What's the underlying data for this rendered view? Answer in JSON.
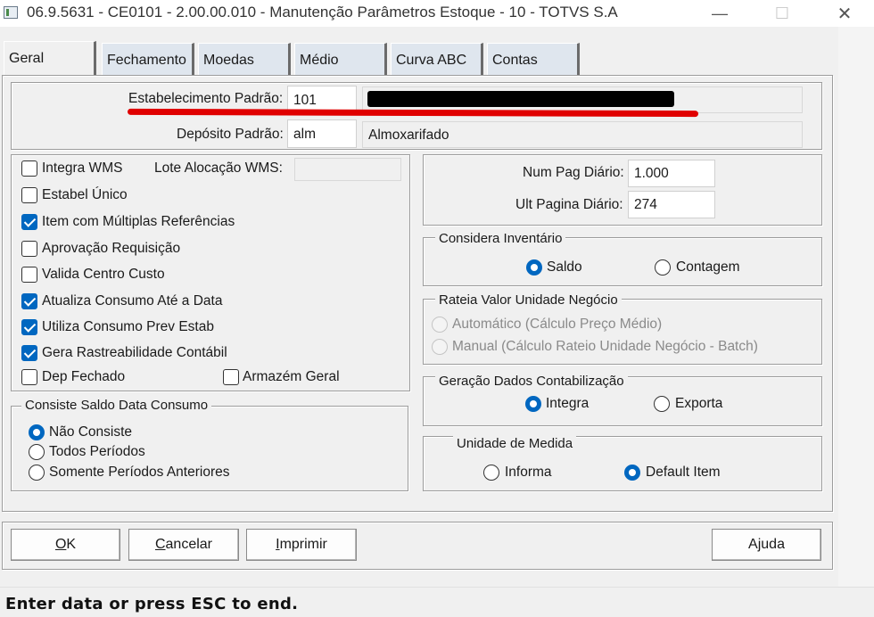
{
  "window": {
    "title": "06.9.5631 - CE0101 - 2.00.00.010 - Manutenção Parâmetros Estoque - 10 - TOTVS S.A",
    "minimize_glyph": "—",
    "maximize_glyph": "☐",
    "close_glyph": "✕"
  },
  "tabs": [
    {
      "label": "Geral",
      "active": true
    },
    {
      "label": "Fechamento"
    },
    {
      "label": "Moedas"
    },
    {
      "label": "Médio"
    },
    {
      "label": "Curva ABC"
    },
    {
      "label": "Contas"
    }
  ],
  "header": {
    "estabelecimento_label": "Estabelecimento Padrão:",
    "estabelecimento_value": "101",
    "estabelecimento_desc": "",
    "deposito_label": "Depósito Padrão:",
    "deposito_value": "alm",
    "deposito_desc": "Almoxarifado"
  },
  "options": {
    "integra_wms": {
      "label": "Integra WMS",
      "checked": false
    },
    "lote_alocacao_label": "Lote Alocação WMS:",
    "lote_alocacao_value": "",
    "estabel_unico": {
      "label": "Estabel Único",
      "checked": false
    },
    "item_multiplas": {
      "label": "Item com Múltiplas Referências",
      "checked": true
    },
    "aprovacao_requisicao": {
      "label": "Aprovação Requisição",
      "checked": false
    },
    "valida_centro_custo": {
      "label": "Valida Centro Custo",
      "checked": false
    },
    "atualiza_consumo": {
      "label": "Atualiza Consumo Até a Data",
      "checked": true
    },
    "utiliza_consumo": {
      "label": "Utiliza Consumo Prev Estab",
      "checked": true
    },
    "gera_rastreabilidade": {
      "label": "Gera Rastreabilidade Contábil",
      "checked": true
    },
    "dep_fechado": {
      "label": "Dep Fechado",
      "checked": false
    },
    "armazem_geral": {
      "label": "Armazém Geral",
      "checked": false
    }
  },
  "consiste_saldo": {
    "legend": "Consiste Saldo Data Consumo",
    "options": [
      {
        "label": "Não Consiste",
        "selected": true
      },
      {
        "label": "Todos Períodos",
        "selected": false
      },
      {
        "label": "Somente Períodos Anteriores",
        "selected": false
      }
    ]
  },
  "diario": {
    "num_pag_label": "Num Pag Diário:",
    "num_pag_value": "1.000",
    "ult_pagina_label": "Ult Pagina Diário:",
    "ult_pagina_value": "274"
  },
  "considera_inventario": {
    "legend": "Considera Inventário",
    "options": [
      {
        "label": "Saldo",
        "selected": true
      },
      {
        "label": "Contagem",
        "selected": false
      }
    ]
  },
  "rateia_valor": {
    "legend": "Rateia Valor Unidade Negócio",
    "options": [
      {
        "label": "Automático (Cálculo Preço Médio)",
        "selected": true,
        "disabled": true
      },
      {
        "label": "Manual (Cálculo Rateio Unidade Negócio - Batch)",
        "selected": false,
        "disabled": true
      }
    ]
  },
  "geracao_dados": {
    "legend": "Geração Dados Contabilização",
    "options": [
      {
        "label": "Integra",
        "selected": true
      },
      {
        "label": "Exporta",
        "selected": false
      }
    ]
  },
  "unidade_medida": {
    "legend": "Unidade de Medida",
    "options": [
      {
        "label": "Informa",
        "selected": false
      },
      {
        "label": "Default Item",
        "selected": true
      }
    ]
  },
  "buttons": {
    "ok_mnemonic": "O",
    "ok_rest": "K",
    "cancelar_mnemonic": "C",
    "cancelar_rest": "ancelar",
    "imprimir_mnemonic": "I",
    "imprimir_rest": "mprimir",
    "ajuda_pre": "A",
    "ajuda_mnemonic": "j",
    "ajuda_rest": "uda"
  },
  "status": {
    "text": "Enter data or press ESC to end."
  },
  "colors": {
    "accent": "#0067c0",
    "annotation_red": "#e00000",
    "redaction": "#000000"
  }
}
